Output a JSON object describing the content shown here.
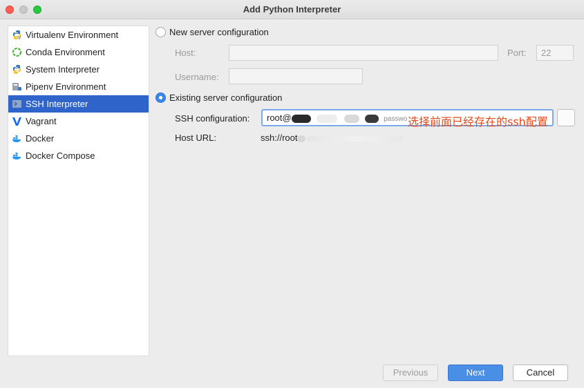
{
  "window": {
    "title": "Add Python Interpreter"
  },
  "sidebar": {
    "items": [
      {
        "label": "Virtualenv Environment",
        "icon": "python-venv-icon"
      },
      {
        "label": "Conda Environment",
        "icon": "conda-icon"
      },
      {
        "label": "System Interpreter",
        "icon": "python-icon"
      },
      {
        "label": "Pipenv Environment",
        "icon": "pipenv-icon"
      },
      {
        "label": "SSH Interpreter",
        "icon": "ssh-terminal-icon",
        "selected": true
      },
      {
        "label": "Vagrant",
        "icon": "vagrant-icon"
      },
      {
        "label": "Docker",
        "icon": "docker-icon"
      },
      {
        "label": "Docker Compose",
        "icon": "docker-compose-icon"
      }
    ]
  },
  "new_server": {
    "radio_label": "New server configuration",
    "host_label": "Host:",
    "host_value": "",
    "port_label": "Port:",
    "port_value": "22",
    "username_label": "Username:",
    "username_value": ""
  },
  "existing_server": {
    "radio_label": "Existing server configuration",
    "ssh_config_label": "SSH configuration:",
    "ssh_config_value_prefix": "root@",
    "ssh_config_value_suffix": "passwo",
    "host_url_label": "Host URL:",
    "host_url_prefix": "ssh://root"
  },
  "annotation": {
    "text": "选择前面已经存在的ssh配置"
  },
  "buttons": {
    "previous": "Previous",
    "next": "Next",
    "cancel": "Cancel"
  },
  "colors": {
    "selection": "#2f65ca",
    "primary_button": "#4a8fe6",
    "annotation": "#e04b1e"
  }
}
